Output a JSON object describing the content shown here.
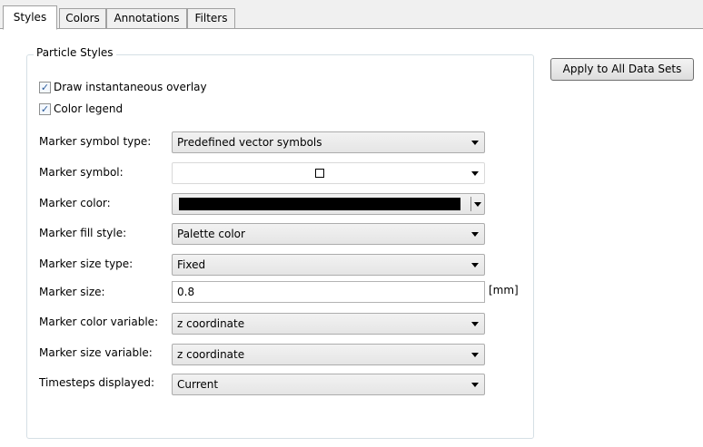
{
  "tabs": [
    {
      "label": "Styles",
      "active": true
    },
    {
      "label": "Colors",
      "active": false
    },
    {
      "label": "Annotations",
      "active": false
    },
    {
      "label": "Filters",
      "active": false
    }
  ],
  "group": {
    "title": "Particle Styles",
    "checkboxes": [
      {
        "label": "Draw instantaneous overlay",
        "checked": true
      },
      {
        "label": "Color legend",
        "checked": true
      }
    ],
    "fields": {
      "marker_symbol_type": {
        "label": "Marker symbol type:",
        "value": "Predefined vector symbols"
      },
      "marker_symbol": {
        "label": "Marker symbol:",
        "value_icon": "hollow-square-symbol"
      },
      "marker_color": {
        "label": "Marker color:",
        "value_color": "#000000"
      },
      "marker_fill_style": {
        "label": "Marker fill style:",
        "value": "Palette color"
      },
      "marker_size_type": {
        "label": "Marker size type:",
        "value": "Fixed"
      },
      "marker_size": {
        "label": "Marker size:",
        "value": "0.8",
        "unit": "[mm]"
      },
      "marker_color_variable": {
        "label": "Marker color variable:",
        "value": "z coordinate"
      },
      "marker_size_variable": {
        "label": "Marker size variable:",
        "value": "z coordinate"
      },
      "timesteps_displayed": {
        "label": "Timesteps displayed:",
        "value": "Current"
      }
    }
  },
  "apply_button": {
    "label": "Apply to All Data Sets"
  },
  "colors": {
    "checkbox_tick": "#2a5a9a",
    "group_border": "#d5dfe5"
  }
}
